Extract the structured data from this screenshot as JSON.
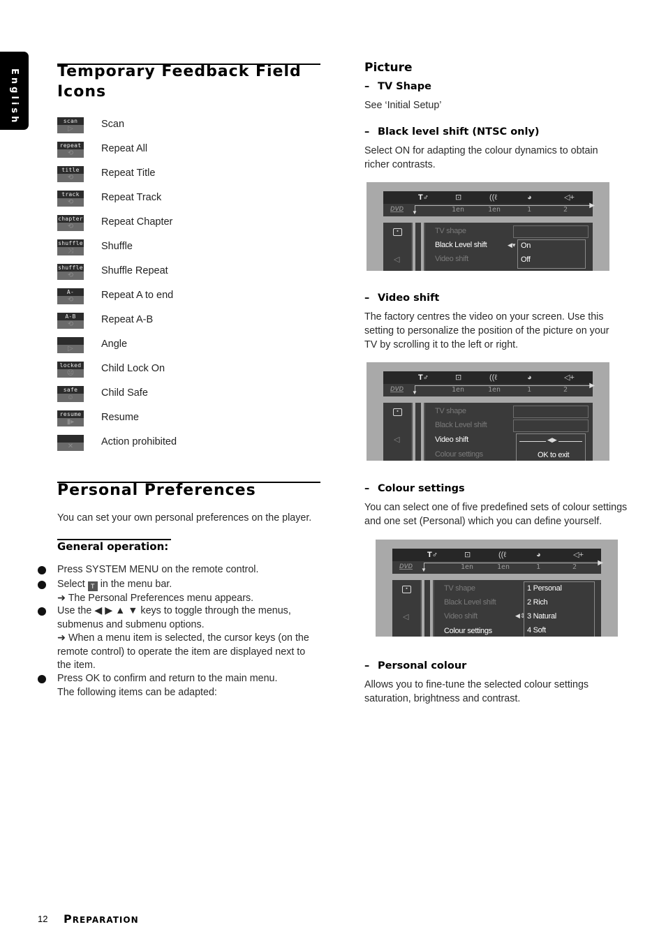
{
  "side_tab": {
    "label": "English"
  },
  "left": {
    "feedback_section": {
      "title_line1": "Temporary Feedback Field",
      "title_line2": "Icons",
      "icons": [
        {
          "tag": "scan",
          "symbol": "▷",
          "icon": "scan-icon",
          "label": "Scan"
        },
        {
          "tag": "repeat",
          "symbol": "⟲",
          "icon": "repeat-all-icon",
          "label": "Repeat All"
        },
        {
          "tag": "title",
          "symbol": "⟲",
          "icon": "repeat-title-icon",
          "label": "Repeat Title"
        },
        {
          "tag": "track",
          "symbol": "⟲",
          "icon": "repeat-track-icon",
          "label": "Repeat Track"
        },
        {
          "tag": "chapter",
          "symbol": "⟲",
          "icon": "repeat-chapter-icon",
          "label": "Repeat Chapter"
        },
        {
          "tag": "shuffle",
          "symbol": "⤨",
          "icon": "shuffle-icon",
          "label": "Shuffle"
        },
        {
          "tag": "shuffle",
          "symbol": "⟲",
          "icon": "shuffle-repeat-icon",
          "label": "Shuffle Repeat"
        },
        {
          "tag": "A-",
          "symbol": "⟲",
          "icon": "repeat-a-to-end-icon",
          "label": "Repeat A to end"
        },
        {
          "tag": "A-B",
          "symbol": "⟲",
          "icon": "repeat-a-b-icon",
          "label": "Repeat A-B"
        },
        {
          "tag": "",
          "symbol": "▷",
          "icon": "angle-icon",
          "label": "Angle"
        },
        {
          "tag": "locked",
          "symbol": "☹",
          "icon": "child-lock-icon",
          "label": "Child Lock On"
        },
        {
          "tag": "safe",
          "symbol": "☺",
          "icon": "child-safe-icon",
          "label": "Child Safe"
        },
        {
          "tag": "resume",
          "symbol": "▮▸",
          "icon": "resume-icon",
          "label": "Resume"
        },
        {
          "tag": "",
          "symbol": "✕",
          "icon": "action-prohibited-icon",
          "label": "Action prohibited"
        }
      ]
    },
    "prefs_section": {
      "title": "Personal Preferences",
      "intro": "You can set your own personal preferences on the player.",
      "general_heading": "General operation:",
      "bullets": {
        "b1": "Press SYSTEM MENU on the remote control.",
        "b2_pre": "Select",
        "b2_post": "in the menu bar.",
        "b2_result": "➜ The Personal Preferences menu appears.",
        "b3_line1": "Use the ◀ ▶ ▲ ▼ keys to toggle through the menus,",
        "b3_line2": "submenus and submenu options.",
        "b3_result1": "➜ When a menu item is selected, the cursor keys (on the",
        "b3_result2": "remote control) to operate the item are displayed next to",
        "b3_result3": "the item.",
        "b4_line1": "Press OK to confirm and return to the main menu.",
        "b4_line2": "The following items can be adapted:"
      }
    }
  },
  "right": {
    "picture_heading": "Picture",
    "tv_shape": {
      "heading": "TV Shape",
      "text": "See ‘Initial Setup’"
    },
    "black_level": {
      "heading": "Black level shift (NTSC only)",
      "text1": "Select ON for adapting the colour dynamics to obtain",
      "text2": "richer contrasts."
    },
    "video_shift": {
      "heading": "Video shift",
      "text1": "The factory centres the video on your screen. Use this",
      "text2": "setting to personalize the position of the picture on your",
      "text3": "TV by scrolling it to the left or right."
    },
    "colour_settings": {
      "heading": "Colour settings",
      "text1": "You can select one of five predefined sets of colour settings",
      "text2": "and one set (Personal) which you can define yourself."
    },
    "personal_colour": {
      "heading": "Personal colour",
      "text1": "Allows you to fine-tune the selected colour settings",
      "text2": "saturation, brightness and contrast."
    },
    "dash": "–"
  },
  "osd": {
    "menubar_icons": [
      "personal-preferences-icon",
      "subtitle-icon",
      "audio-language-icon",
      "angle-globe-icon",
      "sound-icon"
    ],
    "menubar_glyphs": [
      "T♂",
      "⊡",
      "((ℓ",
      "◕",
      "◁+"
    ],
    "disc_label": "DVD",
    "values": [
      "1en",
      "1en",
      "1",
      "2"
    ],
    "items": {
      "tv_shape": "TV shape",
      "black_level": "Black Level shift",
      "video_shift": "Video shift",
      "colour": "Colour settings"
    },
    "screen1": {
      "options": [
        "On",
        "Off"
      ]
    },
    "screen2": {
      "slider": "◀▶",
      "exit": "OK to exit"
    },
    "screen3": {
      "options": [
        "1 Personal",
        "2 Rich",
        "3 Natural",
        "4 Soft"
      ]
    }
  },
  "footer": {
    "page_number": "12",
    "section_cap": "P",
    "section_rest": "REPARATION"
  }
}
